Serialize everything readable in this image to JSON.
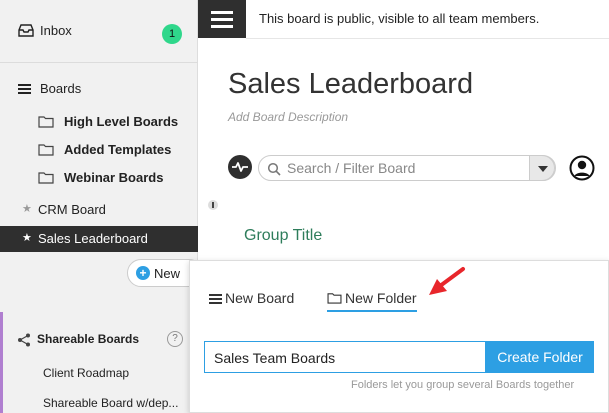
{
  "sidebar": {
    "inbox": {
      "label": "Inbox",
      "badge": "1"
    },
    "boards_header": "Boards",
    "folders": [
      {
        "label": "High Level Boards"
      },
      {
        "label": "Added Templates"
      },
      {
        "label": "Webinar Boards"
      }
    ],
    "boards": [
      {
        "label": "CRM Board",
        "active": false
      },
      {
        "label": "Sales Leaderboard",
        "active": true
      }
    ],
    "new_button": "New",
    "shareable": {
      "header": "Shareable Boards",
      "help": "?",
      "items": [
        "Client Roadmap",
        "Shareable Board w/dep..."
      ]
    }
  },
  "topbar": {
    "notice": "This board is public, visible to all team members."
  },
  "board": {
    "title": "Sales Leaderboard",
    "description": "Add Board Description",
    "search_placeholder": "Search / Filter Board",
    "group_title": "Group Title"
  },
  "popup": {
    "tabs": {
      "new_board": "New Board",
      "new_folder": "New Folder",
      "active": "new_folder"
    },
    "folder_name_value": "Sales Team Boards",
    "create_button": "Create Folder",
    "hint": "Folders let you group several Boards together"
  },
  "colors": {
    "accent_blue": "#2d9fe3",
    "badge_green": "#2fd78b",
    "dark": "#2f2f2f",
    "group_green": "#2e7d5b",
    "annotation_red": "#e8262b",
    "shareable_purple": "#b07fd0"
  },
  "icons": {
    "inbox": "inbox-icon",
    "boards": "hamburger-list-icon",
    "folder": "folder-icon",
    "star": "star-icon",
    "plus": "plus-circle-icon",
    "share": "share-icon",
    "help": "help-icon",
    "menu": "menu-icon",
    "activity": "pulse-icon",
    "search": "search-icon",
    "dropdown": "caret-down-icon",
    "user": "user-avatar-icon",
    "annotation": "red-arrow-annotation"
  }
}
